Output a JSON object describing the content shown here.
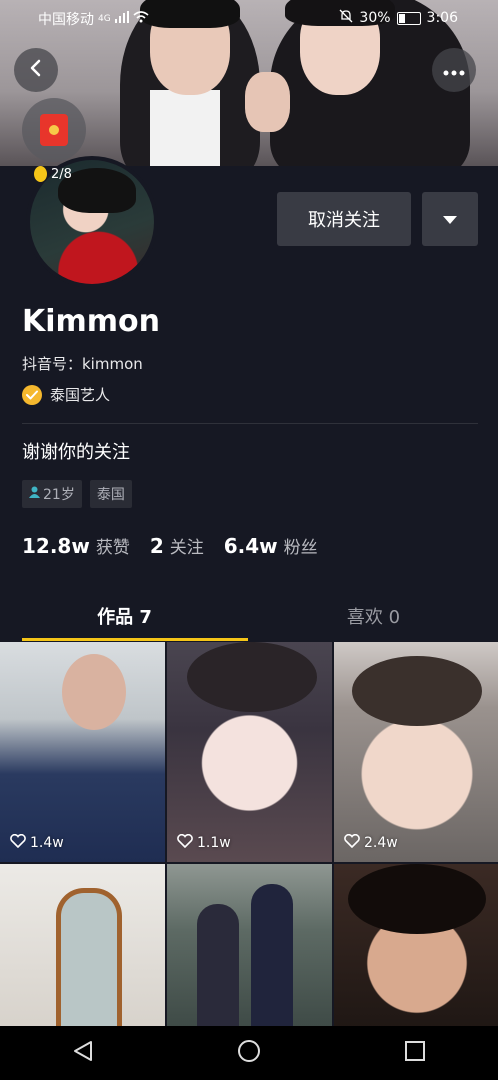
{
  "status_bar": {
    "carrier": "中国移动",
    "network": "4G",
    "battery": "30%",
    "time": "3:06"
  },
  "profile": {
    "coin_count": "2/8",
    "unfollow_label": "取消关注",
    "name": "Kimmon",
    "douyin_id": "抖音号：kimmon",
    "verified_label": "泰国艺人",
    "bio": "谢谢你的关注",
    "tags": {
      "age": "21岁",
      "location": "泰国"
    },
    "stats": {
      "likes_num": "12.8w",
      "likes_label": "获赞",
      "following_num": "2",
      "following_label": "关注",
      "followers_num": "6.4w",
      "followers_label": "粉丝"
    }
  },
  "tabs": {
    "works": "作品 7",
    "likes": "喜欢 0"
  },
  "videos": [
    {
      "likes": "1.4w"
    },
    {
      "likes": "1.1w"
    },
    {
      "likes": "2.4w"
    },
    {
      "likes": ""
    },
    {
      "likes": ""
    },
    {
      "likes": ""
    }
  ],
  "colors": {
    "accent": "#f5c518",
    "background": "#161823",
    "button": "#393b44"
  },
  "icons": [
    "back-icon",
    "more-icon",
    "red-packet-icon",
    "coin-icon",
    "dropdown-icon",
    "verified-icon",
    "person-icon",
    "heart-icon",
    "nav-back-icon",
    "nav-home-icon",
    "nav-recent-icon"
  ]
}
